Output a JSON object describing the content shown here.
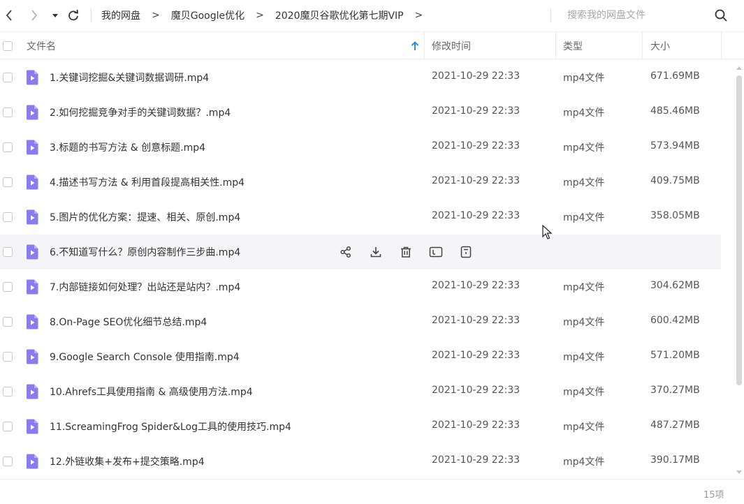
{
  "nav": {
    "back_icon": "chevron-left-icon",
    "forward_icon": "chevron-right-icon",
    "dropdown_icon": "caret-down-icon",
    "refresh_icon": "refresh-icon",
    "breadcrumbs": [
      "我的网盘",
      "魔贝Google优化",
      "2020魔贝谷歌优化第七期VIP"
    ],
    "separator": ">",
    "search_placeholder": "搜索我的网盘文件"
  },
  "columns": {
    "name": "文件名",
    "modified": "修改时间",
    "type": "类型",
    "size": "大小",
    "sort_icon": "arrow-up-icon",
    "sort_color": "#2b8be8"
  },
  "files": [
    {
      "name": "1.关键词挖掘&关键词数据调研.mp4",
      "date": "2021-10-29 22:33",
      "type": "mp4文件",
      "size": "671.69MB"
    },
    {
      "name": "2.如何挖掘竞争对手的关键词数据？.mp4",
      "date": "2021-10-29 22:33",
      "type": "mp4文件",
      "size": "485.46MB"
    },
    {
      "name": "3.标题的书写方法 & 创意标题.mp4",
      "date": "2021-10-29 22:33",
      "type": "mp4文件",
      "size": "573.94MB"
    },
    {
      "name": "4.描述书写方法 & 利用首段提高相关性.mp4",
      "date": "2021-10-29 22:33",
      "type": "mp4文件",
      "size": "409.75MB"
    },
    {
      "name": "5.图片的优化方案：提速、相关、原创.mp4",
      "date": "2021-10-29 22:33",
      "type": "mp4文件",
      "size": "358.05MB"
    },
    {
      "name": "6.不知道写什么？原创内容制作三步曲.mp4",
      "date": "",
      "type": "",
      "size": "",
      "hovered": true
    },
    {
      "name": "7.内部链接如何处理？出站还是站内？.mp4",
      "date": "2021-10-29 22:33",
      "type": "mp4文件",
      "size": "304.62MB"
    },
    {
      "name": "8.On-Page SEO优化细节总结.mp4",
      "date": "2021-10-29 22:33",
      "type": "mp4文件",
      "size": "600.42MB"
    },
    {
      "name": "9.Google Search Console 使用指南.mp4",
      "date": "2021-10-29 22:33",
      "type": "mp4文件",
      "size": "571.20MB"
    },
    {
      "name": "10.Ahrefs工具使用指南 & 高级使用方法.mp4",
      "date": "2021-10-29 22:33",
      "type": "mp4文件",
      "size": "370.27MB"
    },
    {
      "name": "11.ScreamingFrog Spider&Log工具的使用技巧.mp4",
      "date": "2021-10-29 22:33",
      "type": "mp4文件",
      "size": "487.27MB"
    },
    {
      "name": "12.外链收集+发布+提交策略.mp4",
      "date": "2021-10-29 22:33",
      "type": "mp4文件",
      "size": "390.17MB"
    }
  ],
  "row_actions": [
    "share-icon",
    "download-icon",
    "delete-icon",
    "rename-icon",
    "more-icon"
  ],
  "file_icon": "video-file-icon",
  "file_icon_color": "#8a7cf0",
  "footer": {
    "count": "15项"
  }
}
